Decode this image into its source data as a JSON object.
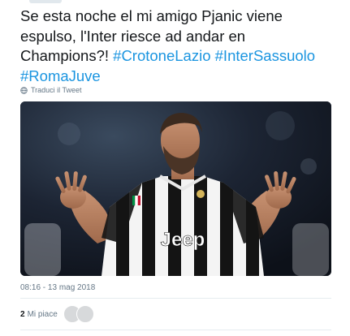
{
  "tweet": {
    "text_plain": "Se esta noche el mi amigo Pjanic viene espulso, l'Inter riesce ad andar en Champions?! ",
    "hashtags": [
      "#CrotoneLazio",
      "#InterSassuolo",
      "#RomaJuve"
    ],
    "translate_label": "Traduci il Tweet",
    "timestamp": "08:16 - 13 mag 2018",
    "likes_count": "2",
    "likes_label": "Mi piace"
  },
  "media": {
    "jersey_sponsor": "Jeep"
  },
  "colors": {
    "text": "#14171a",
    "hashtag": "#1b95e0",
    "muted": "#657786",
    "divider": "#e6ecf0"
  },
  "icons": {
    "translate": "globe-icon"
  }
}
